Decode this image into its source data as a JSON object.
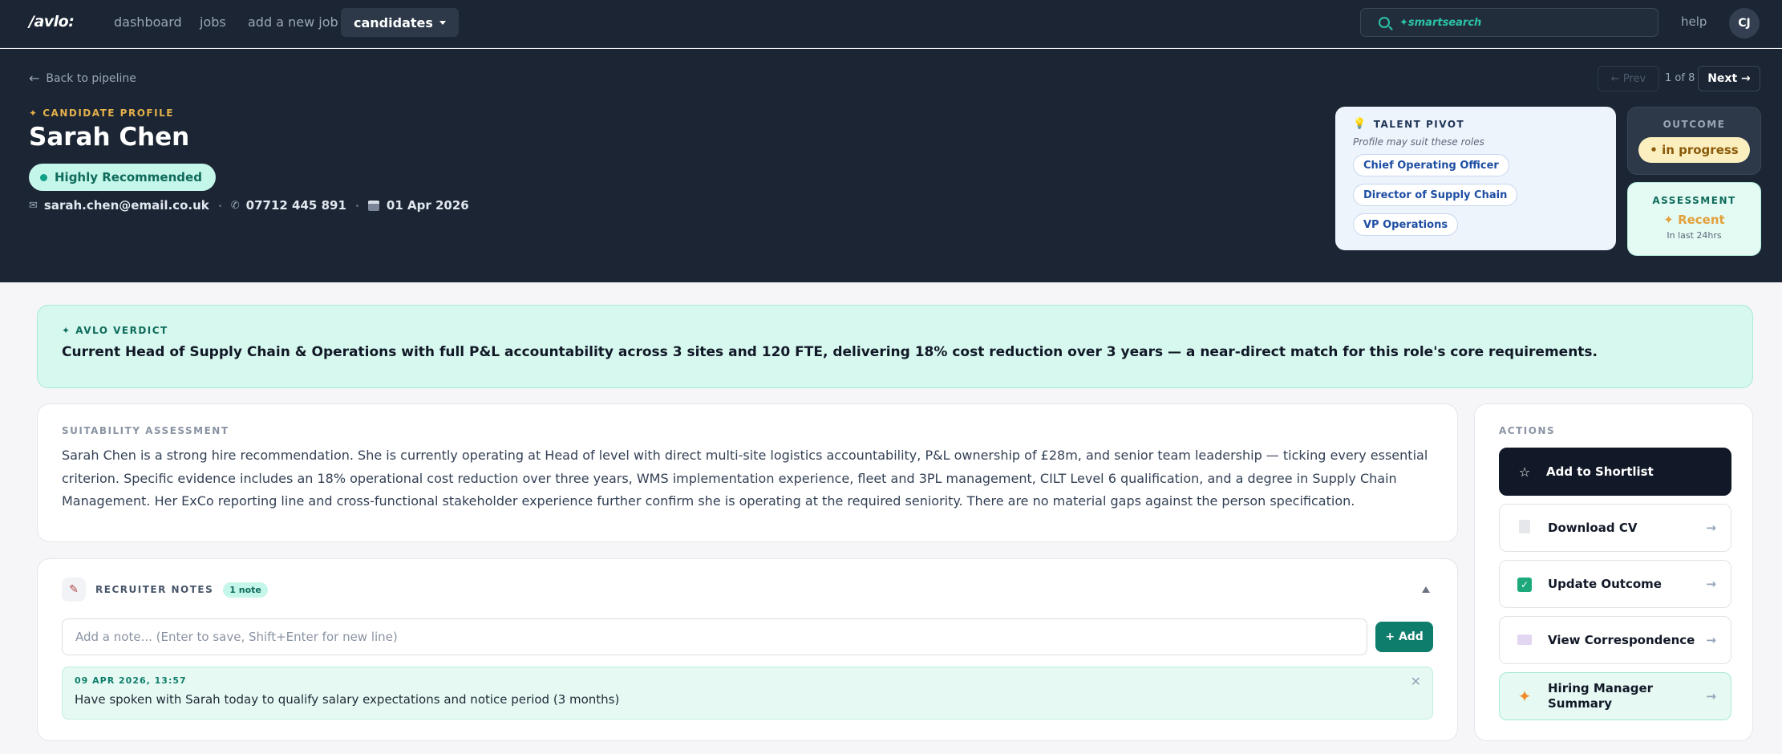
{
  "nav": {
    "logo": "/avlo:",
    "items": [
      "dashboard",
      "jobs",
      "add a new job"
    ],
    "active": "candidates",
    "search_placeholder": "✦smartsearch",
    "help": "help",
    "avatar_initials": "CJ"
  },
  "header": {
    "back_label": "Back to pipeline",
    "pager": {
      "prev": "← Prev",
      "count": "1 of 8",
      "next": "Next →"
    },
    "eyebrow": "✦ CANDIDATE PROFILE",
    "name": "Sarah Chen",
    "recommendation": "Highly Recommended",
    "email": "sarah.chen@email.co.uk",
    "phone": "07712 445 891",
    "date": "01 Apr 2026"
  },
  "pivot": {
    "title": "TALENT PIVOT",
    "subtitle": "Profile may suit these roles",
    "roles": [
      "Chief Operating Officer",
      "Director of Supply Chain",
      "VP Operations"
    ]
  },
  "outcome": {
    "label": "OUTCOME",
    "value": "• in progress"
  },
  "assessment": {
    "label": "ASSESSMENT",
    "value": "✦ Recent",
    "sub": "In last 24hrs"
  },
  "verdict": {
    "label": "✦ AVLO VERDICT",
    "text": "Current Head of Supply Chain & Operations with full P&L accountability across 3 sites and 120 FTE, delivering 18% cost reduction over 3 years — a near-direct match for this role's core requirements."
  },
  "suitability": {
    "label": "SUITABILITY ASSESSMENT",
    "text": "Sarah Chen is a strong hire recommendation. She is currently operating at Head of level with direct multi-site logistics accountability, P&L ownership of £28m, and senior team leadership — ticking every essential criterion. Specific evidence includes an 18% operational cost reduction over three years, WMS implementation experience, fleet and 3PL management, CILT Level 6 qualification, and a degree in Supply Chain Management. Her ExCo reporting line and cross-functional stakeholder experience further confirm she is operating at the required seniority. There are no material gaps against the person specification."
  },
  "notes": {
    "label": "RECRUITER NOTES",
    "badge": "1 note",
    "placeholder": "Add a note... (Enter to save, Shift+Enter for new line)",
    "add_label": "+ Add",
    "items": [
      {
        "date": "09 APR 2026, 13:57",
        "text": "Have spoken with Sarah today to qualify salary expectations and notice period (3 months)"
      }
    ]
  },
  "actions": {
    "label": "ACTIONS",
    "shortlist": "Add to Shortlist",
    "download_cv": "Download CV",
    "update_outcome": "Update Outcome",
    "view_correspondence": "View Correspondence",
    "hiring_summary": "Hiring Manager Summary",
    "arrow": "→"
  }
}
